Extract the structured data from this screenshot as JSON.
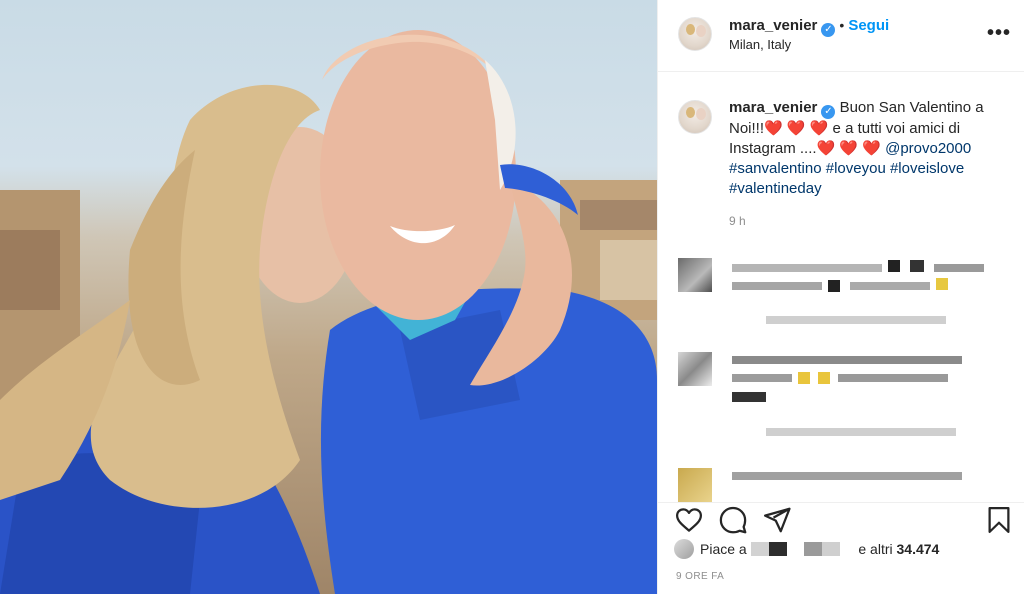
{
  "post": {
    "username": "mara_venier",
    "follow_label": "Segui",
    "separator": "•",
    "location": "Milan, Italy",
    "more_icon": "more-horizontal-icon",
    "more_glyph": "•••"
  },
  "caption": {
    "username": "mara_venier",
    "text_1": "Buon San Valentino a Noi!!!",
    "hearts_1": "❤️ ❤️ ❤️",
    "text_2": " e a tutti voi amici di Instagram ....",
    "hearts_2": "❤️ ❤️ ❤️",
    "mention": "@provo2000",
    "hashtags": [
      "#sanvalentino",
      "#loveyou",
      "#loveislove",
      "#valentineday"
    ],
    "time": "9 h"
  },
  "actions": {
    "like_icon": "heart-icon",
    "comment_icon": "comment-icon",
    "share_icon": "share-icon",
    "save_icon": "bookmark-icon",
    "likes_prefix": "Piace a",
    "likes_suffix_prefix": "e altri",
    "likes_count": "34.474",
    "posted_ago": "9 ORE FA"
  },
  "colors": {
    "link": "#0095f6",
    "hashtag": "#00376b",
    "heart": "#e0162b",
    "verified": "#3897f0",
    "muted": "#8e8e8e"
  }
}
